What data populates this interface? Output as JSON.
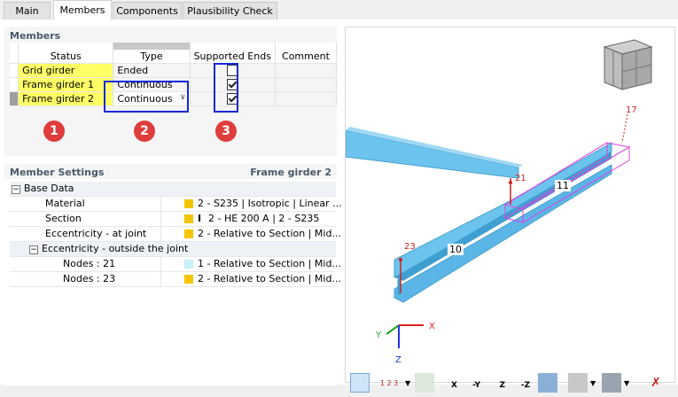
{
  "tabs": [
    {
      "label": "Main",
      "active": false
    },
    {
      "label": "Members",
      "active": true
    },
    {
      "label": "Components",
      "active": false
    },
    {
      "label": "Plausibility Check",
      "active": false
    }
  ],
  "members": {
    "title": "Members",
    "headers": {
      "status": "Status",
      "type": "Type",
      "supported_ends": "Supported Ends",
      "comment": "Comment"
    },
    "rows": [
      {
        "status": "Grid girder",
        "type": "Ended",
        "supported": false
      },
      {
        "status": "Frame girder 1",
        "type": "Continuous",
        "supported": true
      },
      {
        "status": "Frame girder 2",
        "type": "Continuous",
        "supported": true
      }
    ],
    "badges": [
      "1",
      "2",
      "3"
    ],
    "highlight_color": "#1029d8",
    "badge_color": "#e03c3c"
  },
  "member_settings": {
    "title": "Member Settings",
    "selected": "Frame girder 2",
    "groups": [
      {
        "label": "Base Data",
        "items": [
          {
            "label": "Material",
            "value": "2 - S235 | Isotropic | Linear ...",
            "color": "#f5c400"
          },
          {
            "label": "Section",
            "value": "2 - HE 200 A | 2 - S235",
            "color": "#f5c400"
          },
          {
            "label": "Eccentricity - at joint",
            "value": "2 - Relative to Section | Mid...",
            "color": "#f5c400"
          }
        ]
      },
      {
        "label": "Eccentricity - outside the joint",
        "items": [
          {
            "label": "Nodes : 21",
            "value": "1 - Relative to Section | Mid...",
            "color": "#c8f0f8"
          },
          {
            "label": "Nodes : 23",
            "value": "2 - Relative to Section | Mid...",
            "color": "#f5c400"
          }
        ]
      }
    ]
  },
  "view": {
    "node_labels": [
      "17",
      "21",
      "23"
    ],
    "member_labels": [
      "11",
      "10"
    ],
    "axes": {
      "x": "X",
      "y": "Y",
      "z": "Z"
    },
    "toolbar_icons": [
      "view-select-icon",
      "numbering-icon",
      "dropdown-icon",
      "display-icon",
      "view-x-icon",
      "view-minus-y-icon",
      "view-z-icon",
      "view-minus-z-icon",
      "render-icon",
      "box-icon",
      "dropdown-icon",
      "print-icon",
      "dropdown-icon",
      "close-x-icon"
    ],
    "toolbar_labels": {
      "x": "X",
      "minus_y": "-Y",
      "z": "Z",
      "minus_z": "-Z",
      "numbers": "1 2 3"
    }
  }
}
